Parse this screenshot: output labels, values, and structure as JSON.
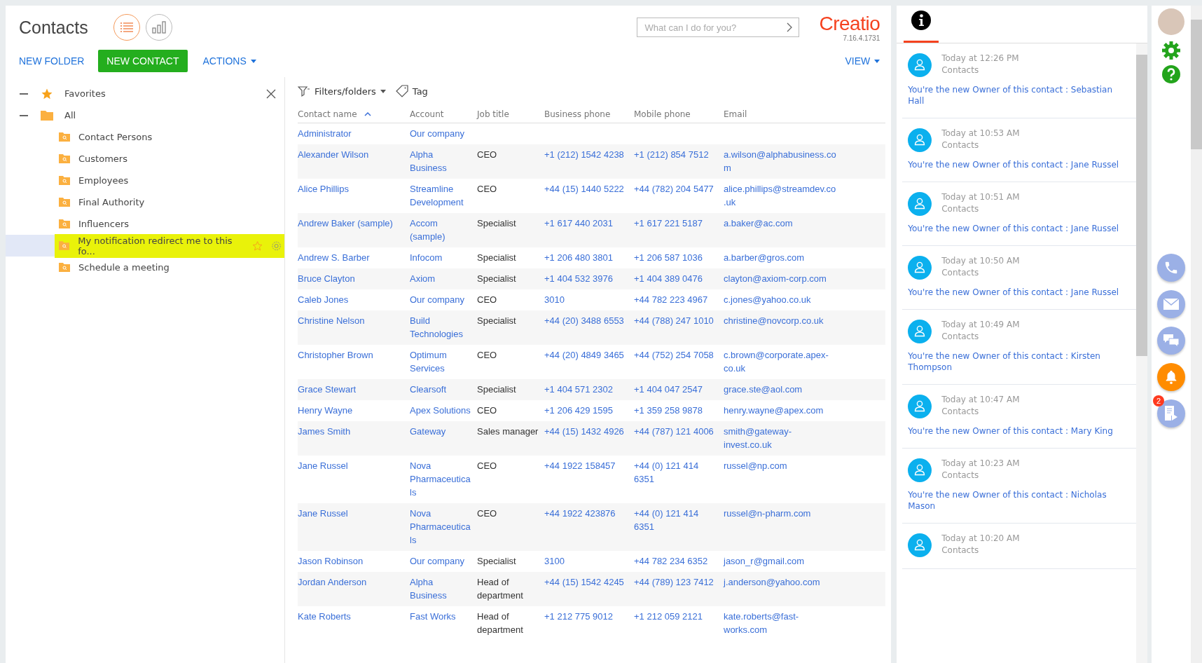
{
  "header": {
    "title": "Contacts",
    "search": {
      "placeholder": "What can I do for you?"
    },
    "logo": "Creatio",
    "version": "7.16.4.1731",
    "view_menu": "VIEW"
  },
  "view_switch": [
    {
      "kind": "list",
      "selected": true
    },
    {
      "kind": "chart",
      "selected": false
    }
  ],
  "toolbar": [
    {
      "label": "NEW FOLDER",
      "kind": "link"
    },
    {
      "label": "NEW CONTACT",
      "kind": "primary"
    },
    {
      "label": "ACTIONS",
      "kind": "dropdown"
    }
  ],
  "folders": [
    {
      "label": "Favorites",
      "kind": "favorites",
      "expanded": true
    },
    {
      "label": "All",
      "kind": "all",
      "expanded": true,
      "children": [
        {
          "label": "Contact Persons",
          "selected": false,
          "highlighted": false
        },
        {
          "label": "Customers",
          "selected": false,
          "highlighted": false
        },
        {
          "label": "Employees",
          "selected": false,
          "highlighted": false
        },
        {
          "label": "Final Authority",
          "selected": false,
          "highlighted": false
        },
        {
          "label": "Influencers",
          "selected": false,
          "highlighted": false
        },
        {
          "label": "My notification redirect me to this fo...",
          "selected": true,
          "highlighted": true
        },
        {
          "label": "Schedule a meeting",
          "selected": false,
          "highlighted": false
        }
      ]
    }
  ],
  "filters": {
    "filter_menu": "Filters/folders",
    "tag": "Tag"
  },
  "table": {
    "columns": [
      {
        "label": "Contact name",
        "sorted": true
      },
      {
        "label": "Account"
      },
      {
        "label": "Job title"
      },
      {
        "label": "Business phone"
      },
      {
        "label": "Mobile phone"
      },
      {
        "label": "Email"
      }
    ],
    "rows": [
      {
        "name": "Administrator",
        "account": "Our company"
      },
      {
        "name": "Alexander Wilson",
        "account": "Alpha Business",
        "job_title": "CEO",
        "business_phone": "+1 (212) 1542 4238",
        "mobile_phone": "+1 (212) 854 7512",
        "email": "a.wilson@alphabusiness.com"
      },
      {
        "name": "Alice Phillips",
        "account": "Streamline Development",
        "job_title": "CEO",
        "business_phone": "+44 (15) 1440 5222",
        "mobile_phone": "+44 (782) 204 5477",
        "email": "alice.phillips@streamdev.co.uk"
      },
      {
        "name": "Andrew Baker (sample)",
        "account": "Accom (sample)",
        "job_title": "Specialist",
        "business_phone": "+1 617 440 2031",
        "mobile_phone": "+1 617 221 5187",
        "email": "a.baker@ac.com"
      },
      {
        "name": "Andrew S. Barber",
        "account": "Infocom",
        "job_title": "Specialist",
        "business_phone": "+1 206 480 3801",
        "mobile_phone": "+1 206 587 1036",
        "email": "a.barber@gros.com"
      },
      {
        "name": "Bruce Clayton",
        "account": "Axiom",
        "job_title": "Specialist",
        "business_phone": "+1 404 532 3976",
        "mobile_phone": "+1 404 389 0476",
        "email": "clayton@axiom-corp.com"
      },
      {
        "name": "Caleb Jones",
        "account": "Our company",
        "job_title": "CEO",
        "business_phone": "3010",
        "mobile_phone": "+44 782 223 4967",
        "email": "c.jones@yahoo.co.uk"
      },
      {
        "name": "Christine Nelson",
        "account": "Build Technologies",
        "job_title": "Specialist",
        "business_phone": "+44 (20) 3488 6553",
        "mobile_phone": "+44 (788) 247 1010",
        "email": "christine@novcorp.co.uk"
      },
      {
        "name": "Christopher Brown",
        "account": "Optimum Services",
        "job_title": "CEO",
        "business_phone": "+44 (20) 4849 3465",
        "mobile_phone": "+44 (752) 254 7058",
        "email": "c.brown@corporate.apex-co.uk"
      },
      {
        "name": "Grace Stewart",
        "account": "Clearsoft",
        "job_title": "Specialist",
        "business_phone": "+1 404 571 2302",
        "mobile_phone": "+1 404 047 2547",
        "email": "grace.ste@aol.com"
      },
      {
        "name": "Henry Wayne",
        "account": "Apex Solutions",
        "job_title": "CEO",
        "business_phone": "+1 206 429 1595",
        "mobile_phone": "+1 359 258 9878",
        "email": "henry.wayne@apex.com"
      },
      {
        "name": "James Smith",
        "account": "Gateway",
        "job_title": "Sales manager",
        "business_phone": "+44 (15) 1432 4926",
        "mobile_phone": "+44 (787) 121 4006",
        "email": "smith@gateway-invest.co.uk"
      },
      {
        "name": "Jane Russel",
        "account": "Nova Pharmaceuticals",
        "job_title": "CEO",
        "business_phone": "+44 1922 158457",
        "mobile_phone": "+44 (0) 121 414 6351",
        "email": "russel@np.com"
      },
      {
        "name": "Jane Russel",
        "account": "Nova Pharmaceuticals",
        "job_title": "CEO",
        "business_phone": "+44 1922 423876",
        "mobile_phone": "+44 (0) 121 414 6351",
        "email": "russel@n-pharm.com"
      },
      {
        "name": "Jason Robinson",
        "account": "Our company",
        "job_title": "Specialist",
        "business_phone": "3100",
        "mobile_phone": "+44 782 234 6352",
        "email": "jason_r@gmail.com"
      },
      {
        "name": "Jordan Anderson",
        "account": "Alpha Business",
        "job_title": "Head of department",
        "business_phone": "+44 (15) 1542 4245",
        "mobile_phone": "+44 (789) 123 7412",
        "email": "j.anderson@yahoo.com"
      },
      {
        "name": "Kate Roberts",
        "account": "Fast Works",
        "job_title": "Head of department",
        "business_phone": "+1 212 775 9012",
        "mobile_phone": "+1 212 059 2121",
        "email": "kate.roberts@fast-works.com"
      }
    ]
  },
  "notification_panel": {
    "tabs": [
      {
        "kind": "info",
        "selected": true
      }
    ],
    "items": [
      {
        "time": "Today at 12:26 PM",
        "section": "Contacts",
        "message": "You're the new Owner of this contact : Sebastian Hall"
      },
      {
        "time": "Today at 10:53 AM",
        "section": "Contacts",
        "message": "You're the new Owner of this contact : Jane Russel"
      },
      {
        "time": "Today at 10:51 AM",
        "section": "Contacts",
        "message": "You're the new Owner of this contact : Jane Russel"
      },
      {
        "time": "Today at 10:50 AM",
        "section": "Contacts",
        "message": "You're the new Owner of this contact : Jane Russel"
      },
      {
        "time": "Today at 10:49 AM",
        "section": "Contacts",
        "message": "You're the new Owner of this contact : Kirsten Thompson"
      },
      {
        "time": "Today at 10:47 AM",
        "section": "Contacts",
        "message": "You're the new Owner of this contact : Mary King"
      },
      {
        "time": "Today at 10:23 AM",
        "section": "Contacts",
        "message": "You're the new Owner of this contact : Nicholas Mason"
      },
      {
        "time": "Today at 10:20 AM",
        "section": "Contacts"
      }
    ]
  },
  "side_bar": [
    {
      "kind": "settings"
    },
    {
      "kind": "help"
    },
    {
      "kind": "phone",
      "active": false
    },
    {
      "kind": "email",
      "active": false
    },
    {
      "kind": "chat",
      "active": false
    },
    {
      "kind": "notifications",
      "active": true
    },
    {
      "kind": "feed",
      "active": false,
      "badge": "2"
    }
  ]
}
